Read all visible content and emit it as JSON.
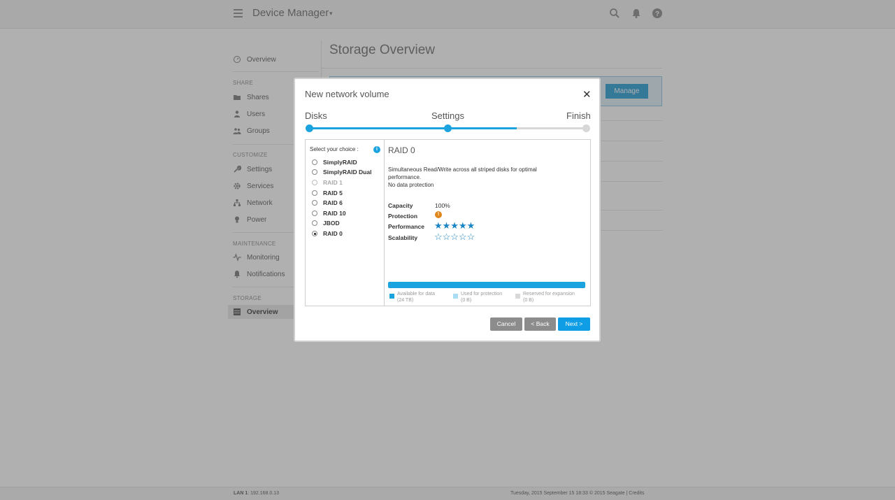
{
  "header": {
    "app_title": "Device Manager",
    "menu_icon": "hamburger-menu-icon",
    "title_caret": "▾",
    "icons": [
      "search-icon",
      "bell-icon",
      "help-icon"
    ]
  },
  "page": {
    "title": "Storage Overview",
    "manage_label": "Manage"
  },
  "sidebar": {
    "overview_top": "Overview",
    "sections": {
      "share": "SHARE",
      "customize": "CUSTOMIZE",
      "maintenance": "MAINTENANCE",
      "storage": "STORAGE"
    },
    "items": {
      "shares": "Shares",
      "users": "Users",
      "groups": "Groups",
      "settings": "Settings",
      "services": "Services",
      "network": "Network",
      "power": "Power",
      "monitoring": "Monitoring",
      "notifications": "Notifications",
      "storage_overview": "Overview"
    },
    "active": "storage_overview"
  },
  "footer": {
    "lan_label": "LAN 1",
    "lan_ip": ": 192.168.0.13",
    "right_text": "Tuesday, 2015 September 15    18:33    © 2015 Seagate | Credits"
  },
  "modal": {
    "title": "New network volume",
    "close": "✕",
    "steps": [
      "Disks",
      "Settings",
      "Finish"
    ],
    "current_step": 2,
    "choices_header": "Select your choice :",
    "info_glyph": "i",
    "choices": [
      {
        "label": "SimplyRAID",
        "disabled": false,
        "selected": false
      },
      {
        "label": "SimplyRAID Dual",
        "disabled": false,
        "selected": false
      },
      {
        "label": "RAID 1",
        "disabled": true,
        "selected": false
      },
      {
        "label": "RAID 5",
        "disabled": false,
        "selected": false
      },
      {
        "label": "RAID 6",
        "disabled": false,
        "selected": false
      },
      {
        "label": "RAID 10",
        "disabled": false,
        "selected": false
      },
      {
        "label": "JBOD",
        "disabled": false,
        "selected": false
      },
      {
        "label": "RAID 0",
        "disabled": false,
        "selected": true
      }
    ],
    "detail": {
      "title": "RAID 0",
      "description_line1": "Simultaneous Read/Write across all striped disks for optimal performance.",
      "description_line2": "No data protection",
      "capacity_label": "Capacity",
      "capacity_value": "100%",
      "protection_label": "Protection",
      "protection_glyph": "!",
      "performance_label": "Performance",
      "performance_stars": "★★★★★",
      "performance_rating": 5,
      "scalability_label": "Scalability",
      "scalability_stars": "☆☆☆☆☆",
      "scalability_rating": 0
    },
    "usage": {
      "available_fraction": 1.0,
      "legend": [
        {
          "line1": "Available for data",
          "line2": "(24 TB)",
          "color": "#1ba3e0"
        },
        {
          "line1": "Used for protection",
          "line2": "(0 B)",
          "color": "#a8ddf4"
        },
        {
          "line1": "Reserved for expansion",
          "line2": "(0 B)",
          "color": "#d8d8d8"
        }
      ]
    },
    "buttons": {
      "cancel": "Cancel",
      "back": "< Back",
      "next": "Next >"
    }
  }
}
